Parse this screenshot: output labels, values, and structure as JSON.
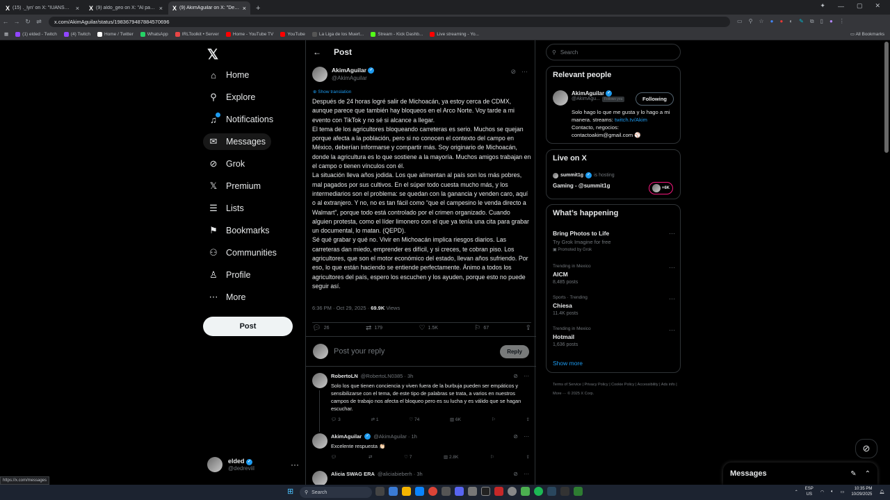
{
  "browser": {
    "tabs": [
      {
        "icon": "X",
        "title": "(15) ._lyn' on X: \"IUANSGUAR"
      },
      {
        "icon": "X",
        "title": "(9) aldo_geo on X: \"Al parecer"
      },
      {
        "icon": "X",
        "title": "(9) AkimAguilar on X: \"Despu"
      }
    ],
    "url": "x.com/AkimAguilar/status/1983679487884570696",
    "bookmarks": [
      {
        "label": "(1) elded - Twitch",
        "color": "#9146ff"
      },
      {
        "label": "(4) Twitch",
        "color": "#9146ff"
      },
      {
        "label": "Home / Twitter",
        "color": "#ffffff"
      },
      {
        "label": "WhatsApp",
        "color": "#25d366"
      },
      {
        "label": "IRLToolkit • Server",
        "color": "#e84545"
      },
      {
        "label": "Home - YouTube TV",
        "color": "#ff0000"
      },
      {
        "label": "YouTube",
        "color": "#ff0000"
      },
      {
        "label": "La Liga de los Muert...",
        "color": "#555555"
      },
      {
        "label": "Stream - Kick Dashb...",
        "color": "#53fc18"
      },
      {
        "label": "Live streaming - Yo...",
        "color": "#ff0000"
      }
    ],
    "all_bookmarks": "All Bookmarks",
    "status_url": "https://x.com/messages"
  },
  "nav": {
    "items": [
      {
        "label": "Home",
        "icon": "home-icon",
        "glyph": "⌂"
      },
      {
        "label": "Explore",
        "icon": "search-icon",
        "glyph": "⚲"
      },
      {
        "label": "Notifications",
        "icon": "bell-icon",
        "glyph": "♫"
      },
      {
        "label": "Messages",
        "icon": "mail-icon",
        "glyph": "✉"
      },
      {
        "label": "Grok",
        "icon": "grok-icon",
        "glyph": "⊘"
      },
      {
        "label": "Premium",
        "icon": "x-icon",
        "glyph": "𝕏"
      },
      {
        "label": "Lists",
        "icon": "list-icon",
        "glyph": "☰"
      },
      {
        "label": "Bookmarks",
        "icon": "bookmark-icon",
        "glyph": "⚑"
      },
      {
        "label": "Communities",
        "icon": "communities-icon",
        "glyph": "⚇"
      },
      {
        "label": "Profile",
        "icon": "person-icon",
        "glyph": "♙"
      },
      {
        "label": "More",
        "icon": "more-circle-icon",
        "glyph": "⋯"
      }
    ],
    "post_button": "Post",
    "account": {
      "name": "elded",
      "handle": "@dedreviil"
    }
  },
  "post": {
    "header": "Post",
    "author_name": "AkimAguilar",
    "author_handle": "@AkimAguilar",
    "show_translation": "Show translation",
    "paragraphs": [
      "Después de 24 horas logré salir de Michoacán, ya estoy cerca de CDMX, aunque parece que también hay bloqueos en el Arco Norte. Voy tarde a mi evento con TikTok y no sé si alcance a llegar.",
      "El tema de los agricultores bloqueando carreteras es serio. Muchos se quejan porque afecta a la población, pero si no conocen el contexto del campo en México, deberían informarse y compartir más. Soy originario de Michoacán, donde la agricultura es lo que sostiene a la mayoría. Muchos amigos trabajan en el campo o tienen vínculos con él.",
      "La situación lleva años jodida. Los que alimentan al país son los más pobres, mal pagados por sus cultivos. En el súper todo cuesta mucho más, y los intermediarios son el problema: se quedan con la ganancia y venden caro, aquí o al extranjero. Y no, no es tan fácil como “que el campesino le venda directo a Walmart”, porque todo está controlado por el crimen organizado. Cuando alguien protesta, como el líder limonero con el que ya tenía una cita para grabar un documental, lo matan. (QEPD).",
      "Sé qué grabar y qué no. Vivir en Michoacán implica riesgos diarios. Las carreteras dan miedo, emprender es difícil, y si creces, te cobran piso. Los agricultores, que son el motor económico del estado, llevan años sufriendo. Por eso, lo que están haciendo se entiende perfectamente. Ánimo a todos los agricultores del país, espero los escuchen y los ayuden, porque esto no puede seguir así."
    ],
    "timestamp": "6:36 PM · Oct 29, 2025 · ",
    "views_count": "69.9K",
    "views_label": " Views",
    "stats": {
      "replies": "26",
      "reposts": "179",
      "likes": "1.5K",
      "bookmarks": "67"
    },
    "reply_placeholder": "Post your reply",
    "reply_button": "Reply"
  },
  "replies": [
    {
      "name": "RobertoLN",
      "handle": "@RobertoLN0385 · 3h",
      "text": "Solo los que tienen conciencia y viven fuera de la burbuja pueden ser empáticos y sensibilizarse con el tema, de este tipo de palabras se trata, a varios en nuestros campos de trabajo nos afecta el bloqueo pero es su lucha y es válido que se hagan escuchar.",
      "replies": "3",
      "reposts": "1",
      "likes": "74",
      "views": "6K"
    },
    {
      "name": "AkimAguilar",
      "handle": "@AkimAguilar · 1h",
      "text": "Excelente respuesta 👏🏻",
      "replies": "",
      "reposts": "",
      "likes": "7",
      "views": "2.8K"
    },
    {
      "name": "Alicia SWAG ERA",
      "handle": "@aliciabieberh · 3h",
      "text": "",
      "replies": "",
      "reposts": "",
      "likes": "",
      "views": ""
    }
  ],
  "sidebar": {
    "search_placeholder": "Search",
    "relevant": {
      "title": "Relevant people",
      "name": "AkimAguilar",
      "handle": "@AkimAgu...",
      "follows_you": "Follows you",
      "follow_button": "Following",
      "bio_1": "Solo hago lo que me gusta y lo hago a mi manera. streams: ",
      "bio_link": "twitch.tv/Akim",
      "bio_2": "Contacto, negocios: contactoakim@gmail.com ⚾"
    },
    "live": {
      "title": "Live on X",
      "host": "summit1g",
      "hosting": "is hosting",
      "stream_title": "Gaming - @summit1g",
      "count": "+6K"
    },
    "happening": {
      "title": "What’s happening",
      "trends": [
        {
          "context": "",
          "title": "Bring Photos to Life",
          "sub": "Try Grok Imagine for free",
          "count": "Promoted by Grok"
        },
        {
          "context": "Trending in Mexico",
          "title": "AICM",
          "sub": "",
          "count": "8,485 posts"
        },
        {
          "context": "Sports · Trending",
          "title": "Chiesa",
          "sub": "",
          "count": "11.4K posts"
        },
        {
          "context": "Trending in Mexico",
          "title": "Hotmail",
          "sub": "",
          "count": "1,636 posts"
        }
      ],
      "show_more": "Show more"
    },
    "footer": "Terms of Service  |  Privacy Policy  |  Cookie Policy  |  Accessibility  |  Ads info  |  More ···  © 2025 X Corp."
  },
  "messages_dock": "Messages",
  "taskbar": {
    "search": "Search",
    "lang": "ESP\nUS",
    "time": "10:35 PM",
    "date": "10/29/2025"
  }
}
